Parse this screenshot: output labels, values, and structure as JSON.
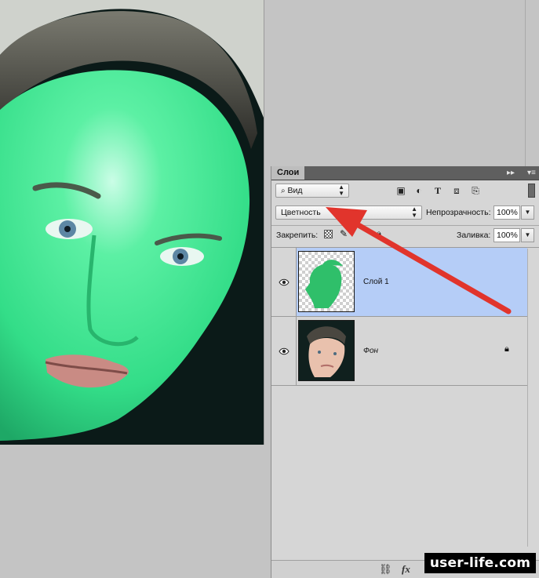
{
  "panel": {
    "tab_label": "Слои",
    "filter_kind_label": "Вид",
    "blend_mode_value": "Цветность",
    "opacity_label": "Непрозрачность:",
    "opacity_value": "100%",
    "lock_label": "Закрепить:",
    "fill_label": "Заливка:",
    "fill_value": "100%"
  },
  "layers": [
    {
      "name": "Слой 1",
      "selected": true,
      "locked": false
    },
    {
      "name": "Фон",
      "selected": false,
      "locked": true
    }
  ],
  "footer": {
    "link_icon": "link-icon",
    "fx_label": "fx"
  },
  "watermark": "user-life.com",
  "colors": {
    "selected_row": "#b5cdf7",
    "arrow": "#e1342c",
    "skin_overlay": "#3ee895",
    "panel_bg": "#d6d6d6",
    "app_bg": "#c4c4c4"
  }
}
